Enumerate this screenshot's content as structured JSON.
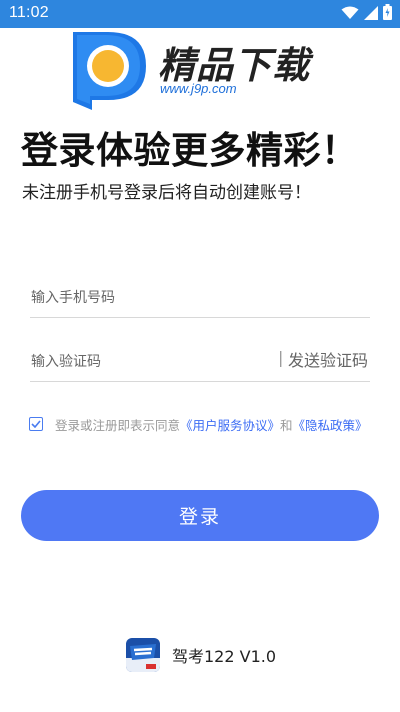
{
  "status_bar": {
    "time": "11:02",
    "color": "#2e86de"
  },
  "logo": {
    "text": "精品下载",
    "url": "www.j9p.com"
  },
  "login": {
    "headline": "登录体验更多精彩！",
    "subtitle": "未注册手机号登录后将自动创建账号！",
    "phone_placeholder": "输入手机号码",
    "code_placeholder": "输入验证码",
    "code_divider": "|",
    "send_code_label": "发送验证码",
    "agreement": {
      "checked": true,
      "prefix": "登录或注册即表示同意",
      "terms_link": "《用户服务协议》",
      "conjunction": "和",
      "privacy_link": "《隐私政策》"
    },
    "submit_label": "登录",
    "accent_color": "#4f78f4"
  },
  "footer": {
    "app_version": "驾考122 V1.0"
  }
}
